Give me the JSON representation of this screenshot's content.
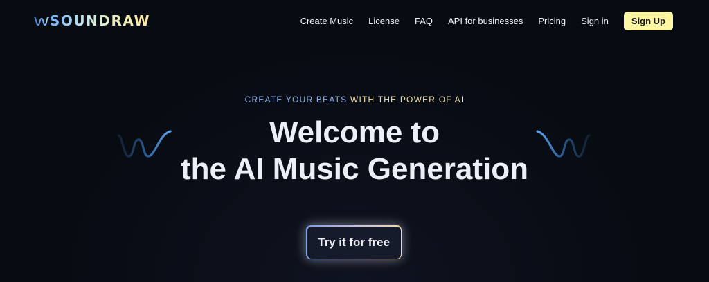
{
  "brand": {
    "name": "SOUNDRAW",
    "logo_icon": "waveform-icon"
  },
  "nav": {
    "links": [
      "Create Music",
      "License",
      "FAQ",
      "API for businesses",
      "Pricing",
      "Sign in"
    ],
    "signup_label": "Sign Up"
  },
  "hero": {
    "eyebrow_part1": "CREATE YOUR BEATS",
    "eyebrow_part2": " WITH THE POWER OF AI",
    "headline_line1": "Welcome to",
    "headline_line2": "the AI Music Generation",
    "cta_label": "Try it for free"
  },
  "colors": {
    "background": "#070b12",
    "signup_bg": "#fdf7a4",
    "accent_blue": "#5b9be0",
    "accent_gold": "#f1dfaa"
  }
}
